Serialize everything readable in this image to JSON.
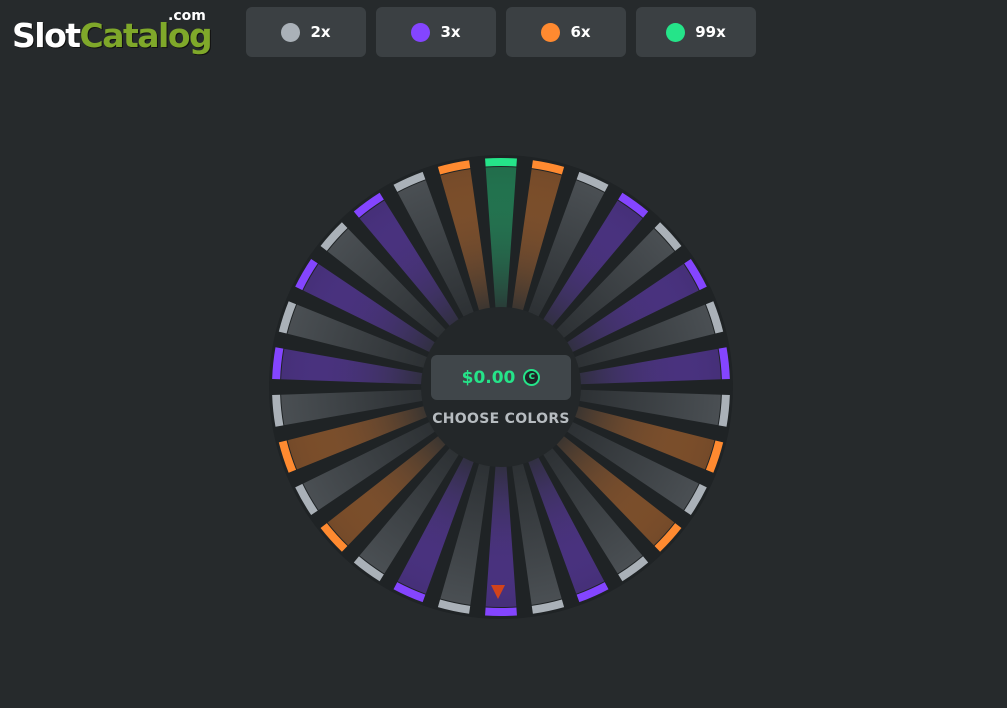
{
  "logo": {
    "part1": "Slot",
    "part2": "Catalog",
    "suffix": ".com"
  },
  "bets": [
    {
      "label": "2x",
      "color": "#aab1b8"
    },
    {
      "label": "3x",
      "color": "#8445ff"
    },
    {
      "label": "6x",
      "color": "#ff8a30"
    },
    {
      "label": "99x",
      "color": "#25e489"
    }
  ],
  "wheel": {
    "segments": [
      "99x",
      "6x",
      "2x",
      "3x",
      "2x",
      "3x",
      "2x",
      "3x",
      "2x",
      "6x",
      "2x",
      "6x",
      "2x",
      "3x",
      "2x",
      "3x",
      "2x",
      "3x",
      "2x",
      "6x",
      "2x",
      "6x",
      "2x",
      "3x",
      "2x",
      "3x",
      "2x",
      "3x",
      "2x",
      "6x"
    ],
    "colors": {
      "2x": "#aab1b8",
      "3x": "#8445ff",
      "6x": "#ff8a30",
      "99x": "#25e489"
    }
  },
  "balance": {
    "amount": "$0.00",
    "currency_icon": "coin-icon"
  },
  "prompt": "CHOOSE COLORS",
  "pointer_icon": "arrow-down-icon"
}
